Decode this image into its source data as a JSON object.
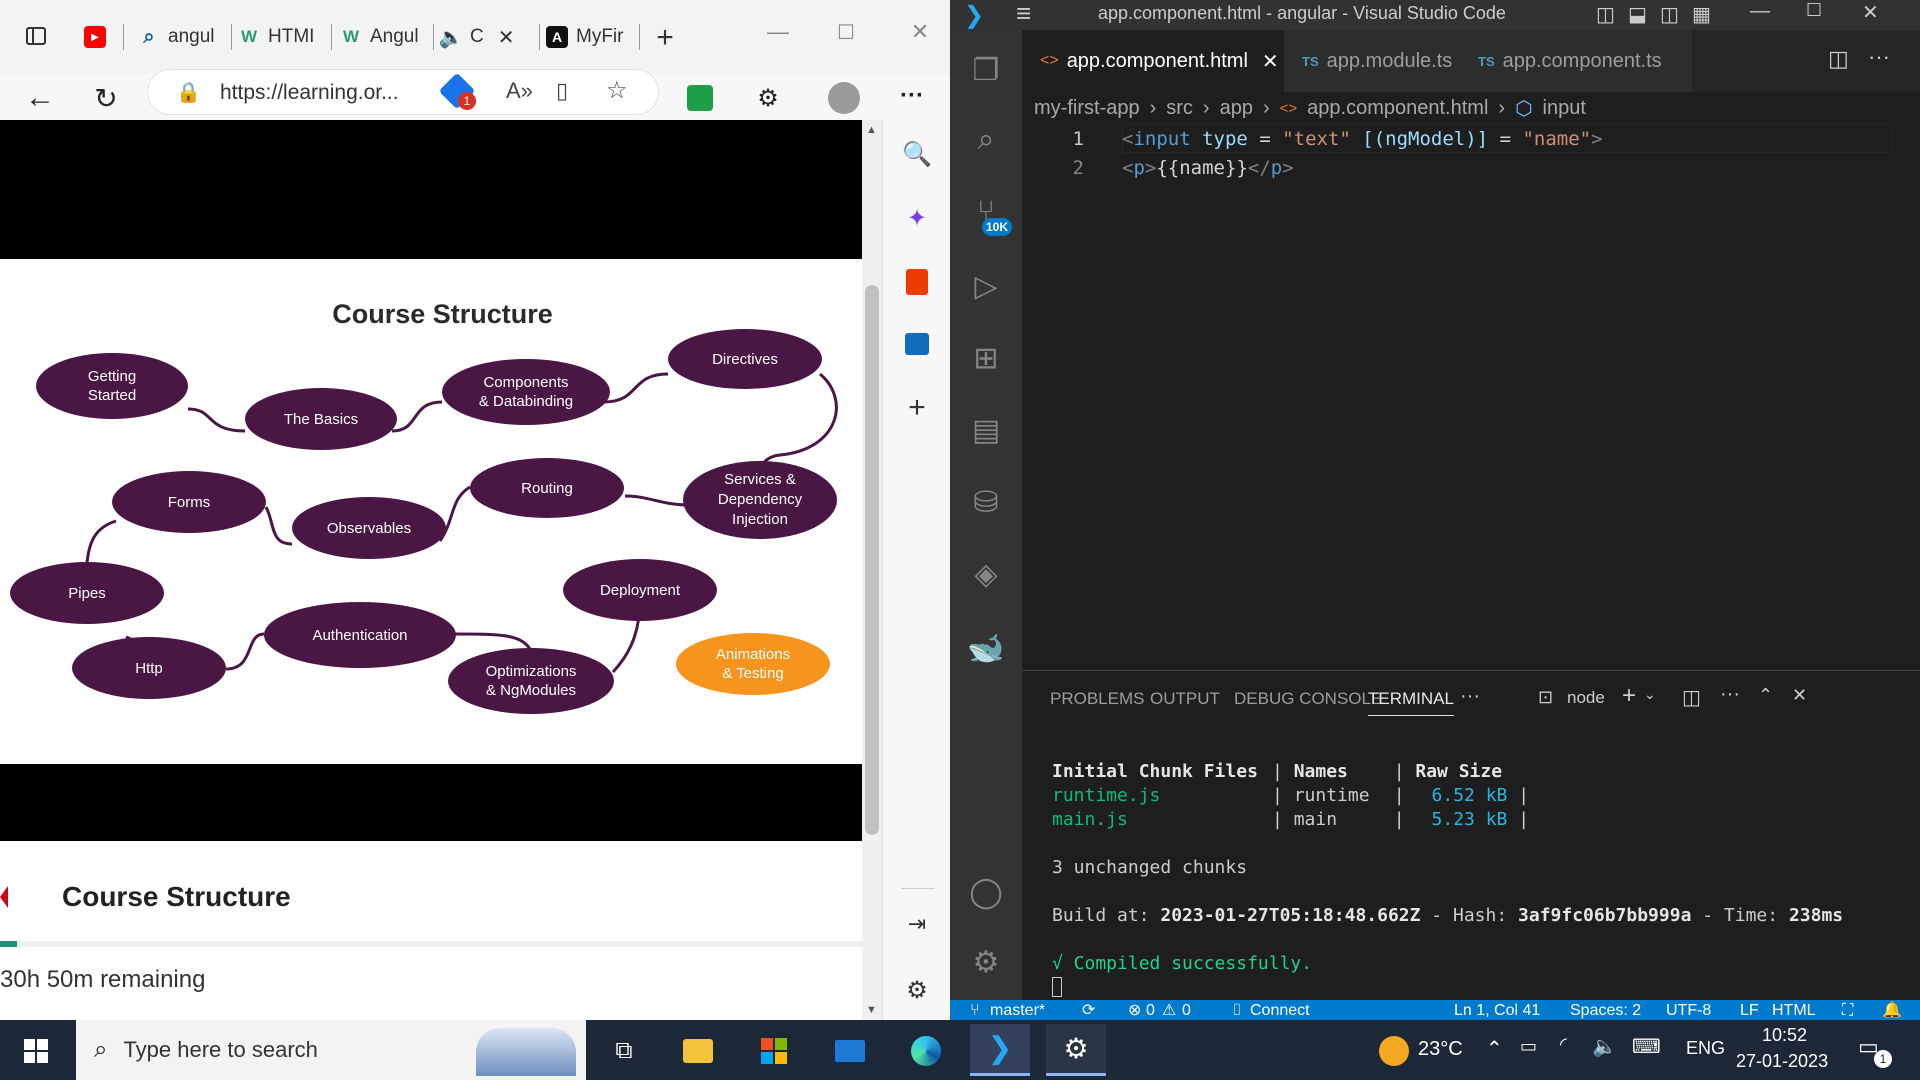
{
  "browser": {
    "tabs": [
      {
        "label": "angul",
        "icon": "search-icon"
      },
      {
        "label": "HTMI",
        "icon": "w-favicon"
      },
      {
        "label": "Angul",
        "icon": "w-favicon"
      },
      {
        "label": "C",
        "icon": "speaker-icon"
      },
      {
        "label": "MyFir",
        "icon": "angular-favicon"
      }
    ],
    "address": "https://learning.or...",
    "notification_count": "1"
  },
  "slide": {
    "title": "Course Structure",
    "nodes": [
      {
        "label": "Getting\nStarted",
        "id": "getting-started"
      },
      {
        "label": "The Basics",
        "id": "the-basics"
      },
      {
        "label": "Components\n& Databinding",
        "id": "components"
      },
      {
        "label": "Directives",
        "id": "directives"
      },
      {
        "label": "Services &\nDependency\nInjection",
        "id": "services"
      },
      {
        "label": "Routing",
        "id": "routing"
      },
      {
        "label": "Observables",
        "id": "observables"
      },
      {
        "label": "Forms",
        "id": "forms"
      },
      {
        "label": "Pipes",
        "id": "pipes"
      },
      {
        "label": "Http",
        "id": "http"
      },
      {
        "label": "Authentication",
        "id": "authentication"
      },
      {
        "label": "Optimizations\n& NgModules",
        "id": "optimizations"
      },
      {
        "label": "Deployment",
        "id": "deployment"
      },
      {
        "label": "Animations\n& Testing",
        "id": "animations"
      }
    ]
  },
  "course": {
    "title": "Course Structure",
    "remaining": "30h 50m remaining",
    "progress": 0.02
  },
  "vscode": {
    "title": "app.component.html - angular - Visual Studio Code",
    "tabs": [
      {
        "label": "app.component.html",
        "prefix": "<>"
      },
      {
        "label": "app.module.ts",
        "prefix": "TS"
      },
      {
        "label": "app.component.ts",
        "prefix": "TS"
      }
    ],
    "breadcrumb": [
      "my-first-app",
      "src",
      "app",
      "app.component.html",
      "input"
    ],
    "scm_badge": "10K",
    "code_lines": [
      {
        "num": "1",
        "parts": [
          "<",
          "input",
          " ",
          "type",
          " = ",
          "\"text\"",
          " ",
          "[(ngModel)]",
          " = ",
          "\"name\"",
          ">"
        ]
      },
      {
        "num": "2",
        "parts": [
          "<",
          "p",
          ">",
          "{{name}}",
          "</",
          "p",
          ">"
        ]
      }
    ],
    "panel_tabs": [
      "PROBLEMS",
      "OUTPUT",
      "DEBUG CONSOLE",
      "TERMINAL"
    ],
    "terminal_shell": "node",
    "terminal": {
      "header": [
        "Initial Chunk Files",
        "Names",
        "Raw Size"
      ],
      "rows": [
        {
          "file": "runtime.js",
          "name": "runtime",
          "size": "6.52 kB"
        },
        {
          "file": "main.js",
          "name": "main",
          "size": "5.23 kB"
        }
      ],
      "unchanged": "3 unchanged chunks",
      "build_label": "Build at: ",
      "build_time": "2023-01-27T05:18:48.662Z",
      "hash_label": " - Hash: ",
      "hash": "3af9fc06b7bb999a",
      "time_label": " - Time: ",
      "time": "238ms",
      "compiled": "√ Compiled successfully."
    },
    "status": {
      "branch": "master*",
      "errors": "0",
      "warnings": "0",
      "connect": "Connect",
      "position": "Ln 1, Col 41",
      "spaces": "Spaces: 2",
      "encoding": "UTF-8",
      "eol": "LF",
      "language": "HTML"
    }
  },
  "taskbar": {
    "search_placeholder": "Type here to search",
    "weather": "23°C",
    "language": "ENG",
    "time": "10:52",
    "date": "27-01-2023",
    "notifications": "1"
  }
}
